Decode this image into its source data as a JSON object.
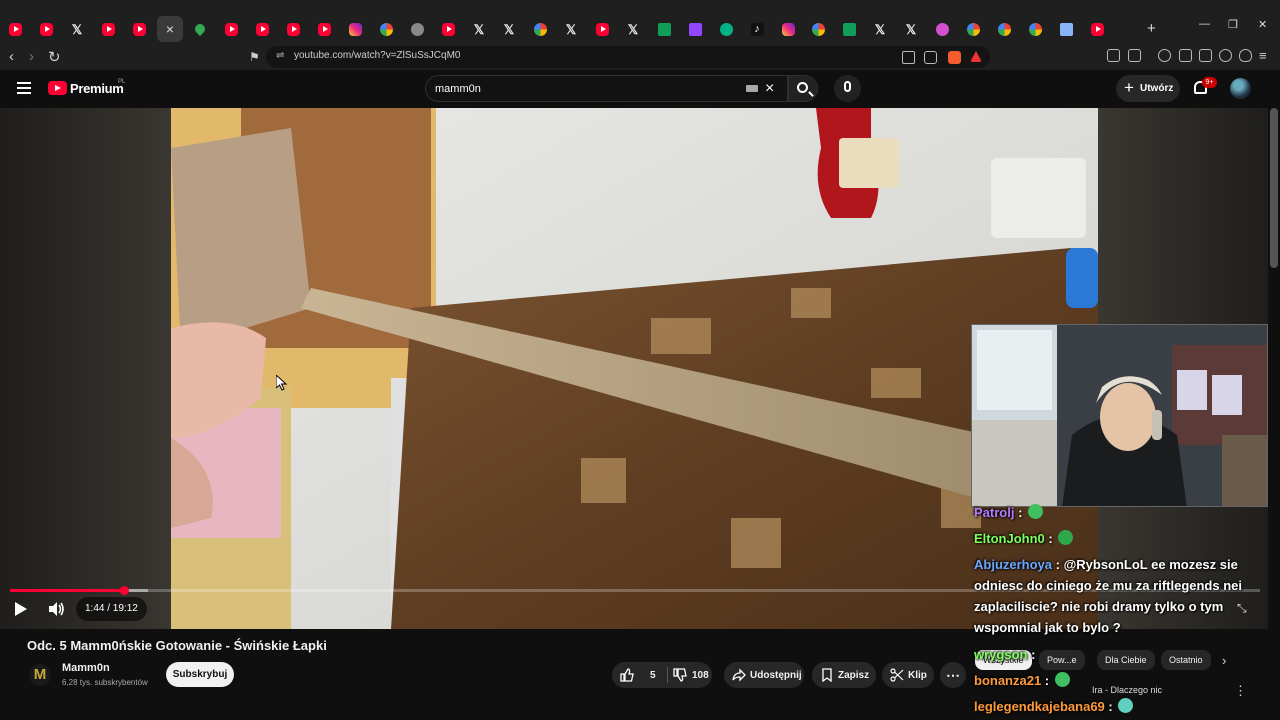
{
  "browser": {
    "tabs": [
      {
        "icon": "youtube-icon",
        "kind": "yt"
      },
      {
        "icon": "youtube-icon",
        "kind": "yt"
      },
      {
        "icon": "x-icon",
        "kind": "x"
      },
      {
        "icon": "youtube-icon",
        "kind": "yt"
      },
      {
        "icon": "youtube-icon",
        "kind": "yt"
      },
      {
        "icon": "close-icon",
        "kind": "active"
      },
      {
        "icon": "maps-icon",
        "kind": "maps"
      },
      {
        "icon": "youtube-icon",
        "kind": "yt"
      },
      {
        "icon": "youtube-icon",
        "kind": "yt"
      },
      {
        "icon": "youtube-icon",
        "kind": "yt"
      },
      {
        "icon": "youtube-icon",
        "kind": "yt"
      },
      {
        "icon": "instagram-icon",
        "kind": "ig"
      },
      {
        "icon": "google-icon",
        "kind": "g"
      },
      {
        "icon": "globe-icon",
        "kind": "grey"
      },
      {
        "icon": "youtube-icon",
        "kind": "yt"
      },
      {
        "icon": "x-icon",
        "kind": "x"
      },
      {
        "icon": "x-icon",
        "kind": "x"
      },
      {
        "icon": "google-icon",
        "kind": "g"
      },
      {
        "icon": "x-icon",
        "kind": "x"
      },
      {
        "icon": "youtube-icon",
        "kind": "yt"
      },
      {
        "icon": "x-icon",
        "kind": "x"
      },
      {
        "icon": "sheets-icon",
        "kind": "sheet"
      },
      {
        "icon": "twitch-icon",
        "kind": "twitch"
      },
      {
        "icon": "app-icon",
        "kind": "green"
      },
      {
        "icon": "tiktok-icon",
        "kind": "tt"
      },
      {
        "icon": "instagram-icon",
        "kind": "ig"
      },
      {
        "icon": "google-icon",
        "kind": "g"
      },
      {
        "icon": "sheets-icon",
        "kind": "sheet"
      },
      {
        "icon": "x-icon",
        "kind": "x"
      },
      {
        "icon": "x-icon",
        "kind": "x"
      },
      {
        "icon": "app-icon",
        "kind": "pink"
      },
      {
        "icon": "google-icon",
        "kind": "g"
      },
      {
        "icon": "google-icon",
        "kind": "g"
      },
      {
        "icon": "google-icon",
        "kind": "g"
      },
      {
        "icon": "book-icon",
        "kind": "book"
      },
      {
        "icon": "youtube-icon",
        "kind": "yt"
      }
    ],
    "new_tab": "+",
    "url": "youtube.com/watch?v=ZlSuSsJCqM0"
  },
  "header": {
    "brand": "Premium",
    "country": "PL",
    "search_value": "mamm0n",
    "create_label": "Utwórz",
    "notifications_badge": "9+"
  },
  "player": {
    "time": "1:44 / 19:12",
    "progress": 0.091,
    "buffered": 0.11
  },
  "video": {
    "title": "Odc. 5 Mamm0ńskie Gotowanie - Świńskie Łapki",
    "channel": "Mamm0n",
    "channel_initial": "M",
    "subscribers": "6,28 tys. subskrybentów",
    "subscribe_label": "Subskrybuj",
    "likes": "5",
    "dislikes": "108",
    "share_label": "Udostępnij",
    "save_label": "Zapisz",
    "clip_label": "Klip",
    "more": "⋯"
  },
  "chat": [
    {
      "user": "Patrolj",
      "color": "#b07bff",
      "text": "",
      "emote": "#3fbf5f"
    },
    {
      "user": "EltonJohn0",
      "color": "#7cff5a",
      "text": "",
      "emote": "#2ea84a"
    },
    {
      "user": "Abjuzerhoya",
      "color": "#6aa8ff",
      "text": "@RybsonLoL ee mozesz sie odniesc do ciniego że mu za riftlegends nei zaplaciliscie? nie robi dramy tylko o tym wspomnial jak to bylo ?",
      "emote": ""
    },
    {
      "user": "wrygson",
      "color": "#7cff5a",
      "text": "",
      "emote": ""
    },
    {
      "user": "bonanza21",
      "color": "#ff9a3c",
      "text": "",
      "emote": "#3fbf5f"
    },
    {
      "user": "leglegendkajebana69",
      "color": "#ff9a3c",
      "text": "",
      "emote": "#5fd0c0"
    }
  ],
  "recommendations": {
    "chips": [
      "Wszystkie",
      "Pow...e",
      "Dla Ciebie",
      "Ostatnio"
    ],
    "next_item_title": "Ira - Dlaczego nic"
  },
  "colors": {
    "accent": "#ff0033",
    "background": "#0f0f0f"
  }
}
